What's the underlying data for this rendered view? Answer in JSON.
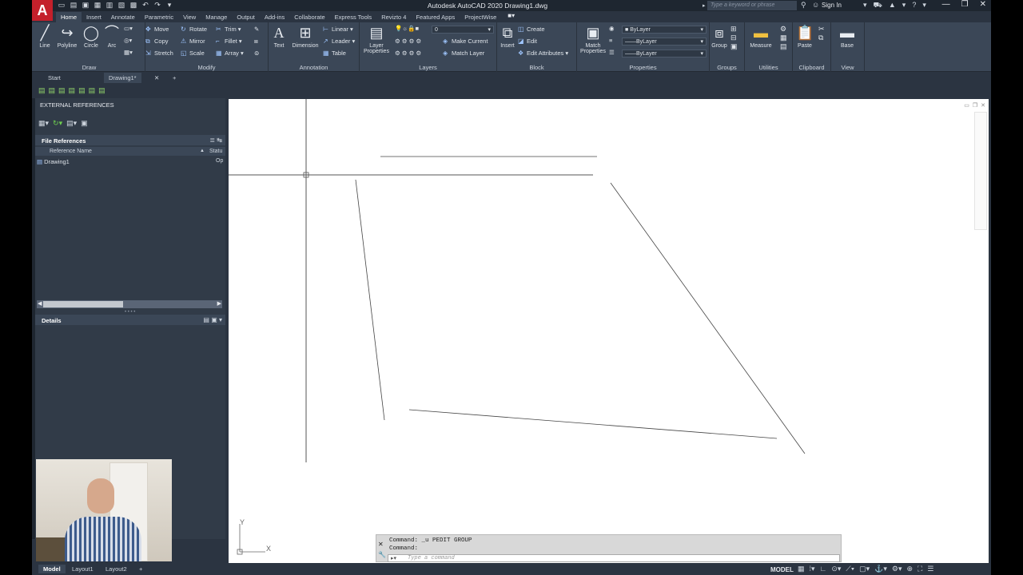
{
  "titlebar": {
    "app_logo": "A",
    "title": "Autodesk AutoCAD 2020   Drawing1.dwg",
    "search_placeholder": "Type a keyword or phrase",
    "sign_in": "Sign In"
  },
  "ribbon_tabs": [
    "Home",
    "Insert",
    "Annotate",
    "Parametric",
    "View",
    "Manage",
    "Output",
    "Add-ins",
    "Collaborate",
    "Express Tools",
    "Revizto 4",
    "Featured Apps",
    "ProjectWise"
  ],
  "ribbon": {
    "draw": {
      "title": "Draw",
      "line": "Line",
      "polyline": "Polyline",
      "circle": "Circle",
      "arc": "Arc"
    },
    "modify": {
      "title": "Modify",
      "move": "Move",
      "rotate": "Rotate",
      "trim": "Trim",
      "copy": "Copy",
      "mirror": "Mirror",
      "fillet": "Fillet",
      "stretch": "Stretch",
      "scale": "Scale",
      "array": "Array"
    },
    "annotation": {
      "title": "Annotation",
      "text": "Text",
      "dimension": "Dimension",
      "linear": "Linear",
      "leader": "Leader",
      "table": "Table"
    },
    "layers": {
      "title": "Layers",
      "layer_properties": "Layer Properties",
      "layer_value": "0",
      "make_current": "Make Current",
      "match_layer": "Match Layer"
    },
    "block": {
      "title": "Block",
      "insert": "Insert",
      "create": "Create",
      "edit": "Edit",
      "edit_attributes": "Edit Attributes"
    },
    "properties": {
      "title": "Properties",
      "match_properties": "Match Properties",
      "color": "ByLayer",
      "linetype": "ByLayer",
      "lineweight": "ByLayer"
    },
    "groups": {
      "title": "Groups",
      "group": "Group"
    },
    "utilities": {
      "title": "Utilities",
      "measure": "Measure"
    },
    "clipboard": {
      "title": "Clipboard",
      "paste": "Paste"
    },
    "view": {
      "title": "View",
      "base": "Base"
    }
  },
  "filetabs": {
    "start": "Start",
    "drawing": "Drawing1*"
  },
  "xref": {
    "title": "EXTERNAL REFERENCES",
    "file_references": "File References",
    "col_name": "Reference Name",
    "col_status": "Statu",
    "row_name": "Drawing1",
    "row_status": "Op",
    "details": "Details"
  },
  "command": {
    "history1": "Command: _u PEDIT GROUP",
    "history2": "Command:",
    "placeholder": "Type a command"
  },
  "statusbar": {
    "model_tab": "Model",
    "layout1": "Layout1",
    "layout2": "Layout2",
    "add": "+",
    "model_label": "MODEL"
  },
  "ucs": {
    "x": "X",
    "y": "Y"
  },
  "icons": {
    "logo": "autocad-logo-icon",
    "search": "binoculars-icon",
    "user": "user-icon",
    "help": "help-icon"
  },
  "colors": {
    "accent": "#c4202b",
    "ribbon": "#3b4757",
    "canvas": "#ffffff"
  }
}
